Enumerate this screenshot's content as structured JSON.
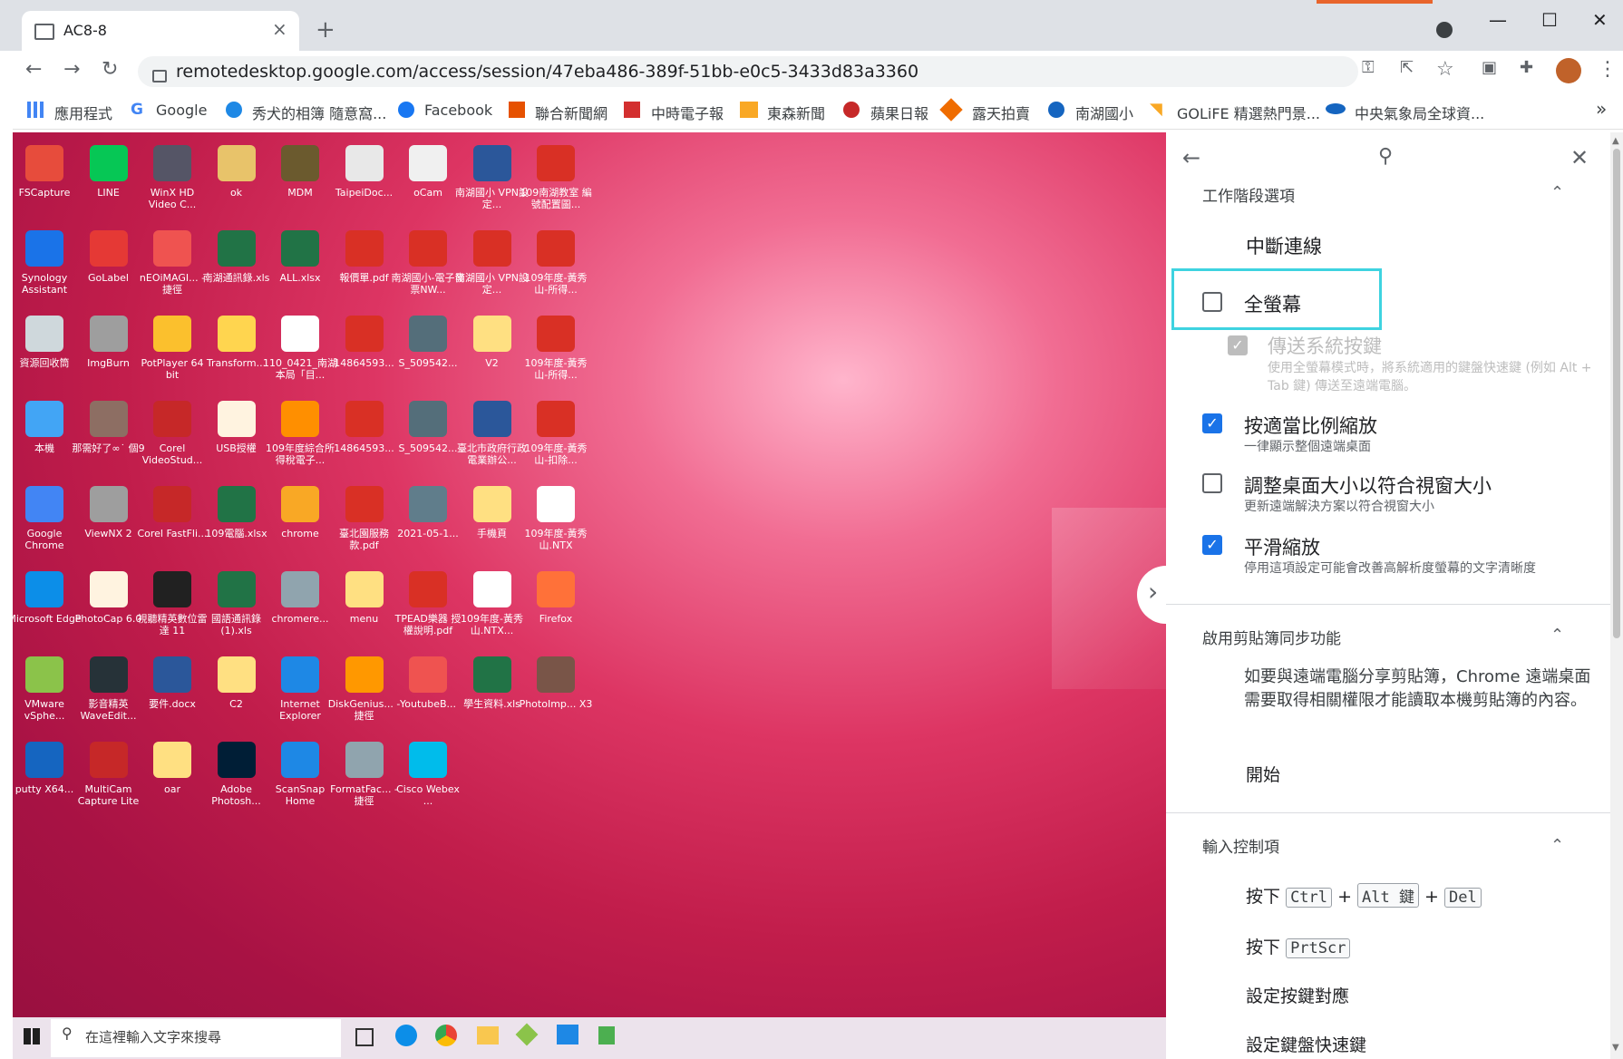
{
  "browser": {
    "tab_title": "AC8-8",
    "tab_close": "×",
    "new_tab": "+",
    "url": "remotedesktop.google.com/access/session/47eba486-389f-51bb-e0c5-3433d83a3360"
  },
  "bookmarks": [
    {
      "label": "應用程式"
    },
    {
      "label": "Google"
    },
    {
      "label": "秀犬的相簿 隨意窩..."
    },
    {
      "label": "Facebook"
    },
    {
      "label": "聯合新聞網"
    },
    {
      "label": "中時電子報"
    },
    {
      "label": "東森新聞"
    },
    {
      "label": "蘋果日報"
    },
    {
      "label": "露天拍賣"
    },
    {
      "label": "南湖國小"
    },
    {
      "label": "GOLiFE 精選熱門景..."
    },
    {
      "label": "中央氣象局全球資..."
    }
  ],
  "bookmarks_more": "»",
  "desktop_icons": [
    {
      "label": "FSCapture",
      "color": "#e74c3c"
    },
    {
      "label": "LINE",
      "color": "#06c755"
    },
    {
      "label": "WinX HD Video C...",
      "color": "#555566"
    },
    {
      "label": "ok",
      "color": "#e8c36a"
    },
    {
      "label": "MDM",
      "color": "#6b5a2e"
    },
    {
      "label": "TaipeiDoc...",
      "color": "#e8e8e8"
    },
    {
      "label": "oCam",
      "color": "#f0f0f0"
    },
    {
      "label": "南湖國小 VPN設定...",
      "color": "#2b579a"
    },
    {
      "label": "109南湖教室 編號配置圖...",
      "color": "#d93025"
    },
    {
      "label": "Synology Assistant",
      "color": "#1a73e8"
    },
    {
      "label": "GoLabel",
      "color": "#e53935"
    },
    {
      "label": "nEOiMAGI... - 捷徑",
      "color": "#ef5350"
    },
    {
      "label": "南湖通訊錄.xls",
      "color": "#217346"
    },
    {
      "label": "ALL.xlsx",
      "color": "#217346"
    },
    {
      "label": "報價單.pdf",
      "color": "#d93025"
    },
    {
      "label": "南湖國小-電子發票NW...",
      "color": "#d93025"
    },
    {
      "label": "南湖國小 VPN設定...",
      "color": "#d93025"
    },
    {
      "label": "109年度-黃秀山-所得...",
      "color": "#d93025"
    },
    {
      "label": "資源回收筒",
      "color": "#cfd8dc"
    },
    {
      "label": "ImgBurn",
      "color": "#9e9e9e"
    },
    {
      "label": "PotPlayer 64 bit",
      "color": "#fbc02d"
    },
    {
      "label": "Transform...",
      "color": "#ffd54f"
    },
    {
      "label": "110_0421_南湖本局「目...",
      "color": "#ffffff"
    },
    {
      "label": "14864593...",
      "color": "#d93025"
    },
    {
      "label": "S_509542...",
      "color": "#546e7a"
    },
    {
      "label": "V2",
      "color": "#ffe082"
    },
    {
      "label": "109年度-黃秀山-所得...",
      "color": "#d93025"
    },
    {
      "label": "本機",
      "color": "#42a5f5"
    },
    {
      "label": "那需好了∞˙ 個9",
      "color": "#8d6e63"
    },
    {
      "label": "Corel VideoStud...",
      "color": "#c62828"
    },
    {
      "label": "USB授權",
      "color": "#fff3e0"
    },
    {
      "label": "109年度綜合所得稅電子...",
      "color": "#ff8f00"
    },
    {
      "label": "14864593...",
      "color": "#d93025"
    },
    {
      "label": "S_509542...",
      "color": "#546e7a"
    },
    {
      "label": "臺北市政府行政電業辦公...",
      "color": "#2b579a"
    },
    {
      "label": "109年度-黃秀山-扣除...",
      "color": "#d93025"
    },
    {
      "label": "Google Chrome",
      "color": "#4285f4"
    },
    {
      "label": "ViewNX 2",
      "color": "#9e9e9e"
    },
    {
      "label": "Corel FastFli...",
      "color": "#c62828"
    },
    {
      "label": "109電腦.xlsx",
      "color": "#217346"
    },
    {
      "label": "chrome",
      "color": "#f9a825"
    },
    {
      "label": "臺北園服務款.pdf",
      "color": "#d93025"
    },
    {
      "label": "2021-05-1...",
      "color": "#607d8b"
    },
    {
      "label": "手機頁",
      "color": "#ffe082"
    },
    {
      "label": "109年度-黃秀山.NTX",
      "color": "#ffffff"
    },
    {
      "label": "Microsoft Edge",
      "color": "#0c8ee8"
    },
    {
      "label": "PhotoCap 6.0",
      "color": "#fff3e0"
    },
    {
      "label": "視聽精英數位雷達 11",
      "color": "#212121"
    },
    {
      "label": "國語通訊錄 (1).xls",
      "color": "#217346"
    },
    {
      "label": "chromere...",
      "color": "#90a4ae"
    },
    {
      "label": "menu",
      "color": "#ffe082"
    },
    {
      "label": "TPEAD樂器 授權說明.pdf",
      "color": "#d93025"
    },
    {
      "label": "109年度-黃秀山.NTX...",
      "color": "#ffffff"
    },
    {
      "label": "Firefox",
      "color": "#ff7139"
    },
    {
      "label": "VMware vSphe...",
      "color": "#8bc34a"
    },
    {
      "label": "影音精英 WaveEdit...",
      "color": "#263238"
    },
    {
      "label": "要件.docx",
      "color": "#2b579a"
    },
    {
      "label": "C2",
      "color": "#ffe082"
    },
    {
      "label": "Internet Explorer",
      "color": "#1e88e5"
    },
    {
      "label": "DiskGenius... - 捷徑",
      "color": "#ff9800"
    },
    {
      "label": "YoutubeB...",
      "color": "#ef5350"
    },
    {
      "label": "學生資料.xls",
      "color": "#217346"
    },
    {
      "label": "PhotoImp... X3",
      "color": "#795548"
    },
    {
      "label": "putty X64...",
      "color": "#1565c0"
    },
    {
      "label": "MultiCam Capture Lite",
      "color": "#c62828"
    },
    {
      "label": "oar",
      "color": "#ffe082"
    },
    {
      "label": "Adobe Photosh...",
      "color": "#001e36"
    },
    {
      "label": "ScanSnap Home",
      "color": "#1e88e5"
    },
    {
      "label": "FormatFac... - 捷徑",
      "color": "#90a4ae"
    },
    {
      "label": "Cisco Webex ...",
      "color": "#00bceb"
    }
  ],
  "taskbar": {
    "search_placeholder": "在這裡輸入文字來搜尋"
  },
  "panel": {
    "session_header": "工作階段選項",
    "disconnect": "中斷連線",
    "fullscreen": "全螢幕",
    "send_system_keys": "傳送系統按鍵",
    "send_system_keys_desc": "使用全螢幕模式時，將系統適用的鍵盤快速鍵 (例如 Alt + Tab 鍵) 傳送至遠端電腦。",
    "scale_to_fit": "按適當比例縮放",
    "scale_to_fit_desc": "一律顯示整個遠端桌面",
    "resize_to_fit": "調整桌面大小以符合視窗大小",
    "resize_to_fit_desc": "更新遠端解決方案以符合視窗大小",
    "smooth_scaling": "平滑縮放",
    "smooth_scaling_desc": "停用這項設定可能會改善高解析度螢幕的文字清晰度",
    "clipboard_header": "啟用剪貼簿同步功能",
    "clipboard_desc": "如要與遠端電腦分享剪貼簿，Chrome 遠端桌面需要取得相關權限才能讀取本機剪貼簿的內容。",
    "start": "開始",
    "input_header": "輸入控制項",
    "press": "按下",
    "key_ctrl": "Ctrl",
    "key_alt": "Alt 鍵",
    "key_del": "Del",
    "key_prtscr": "PrtScr",
    "key_mapping": "設定按鍵對應",
    "keyboard_shortcuts": "設定鍵盤快速鍵"
  },
  "colors": {
    "checkbox_blue": "#1a73e8",
    "highlight": "#3ed3e0"
  }
}
